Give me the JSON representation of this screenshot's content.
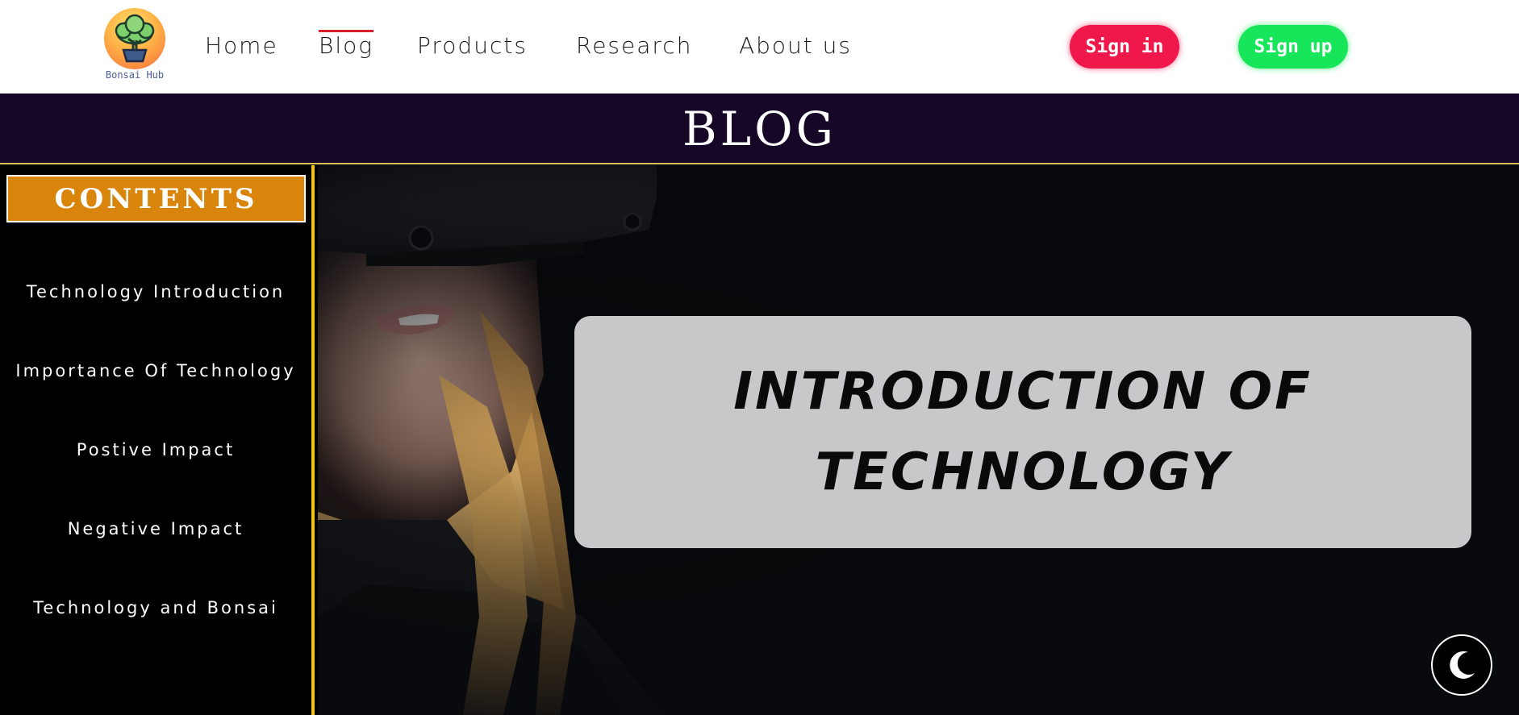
{
  "brand": {
    "name": "Bonsai Hub",
    "logo_icon": "bonsai-tree-icon"
  },
  "nav": {
    "items": [
      {
        "label": "Home"
      },
      {
        "label": "Blog",
        "active": true
      },
      {
        "label": "Products"
      },
      {
        "label": "Research"
      },
      {
        "label": "About us"
      }
    ]
  },
  "auth": {
    "signin_label": "Sign in",
    "signup_label": "Sign up"
  },
  "banner": {
    "title": "BLOG"
  },
  "sidebar": {
    "heading": "CONTENTS",
    "items": [
      {
        "label": "Technology Introduction"
      },
      {
        "label": "Importance Of Technology"
      },
      {
        "label": "Postive Impact"
      },
      {
        "label": "Negative Impact"
      },
      {
        "label": "Technology and Bonsai"
      }
    ]
  },
  "hero": {
    "title_line1": "INTRODUCTION OF",
    "title_line2": "TECHNOLOGY",
    "image": "woman-wearing-vr-headset"
  },
  "theme_toggle": {
    "icon": "moon-icon"
  },
  "colors": {
    "signin": "#f0174a",
    "signup": "#18e65a",
    "banner_bg": "#170726",
    "contents_bg": "#d9850b",
    "sidebar_border": "#f2c417",
    "nav_active": "#d8202a"
  }
}
